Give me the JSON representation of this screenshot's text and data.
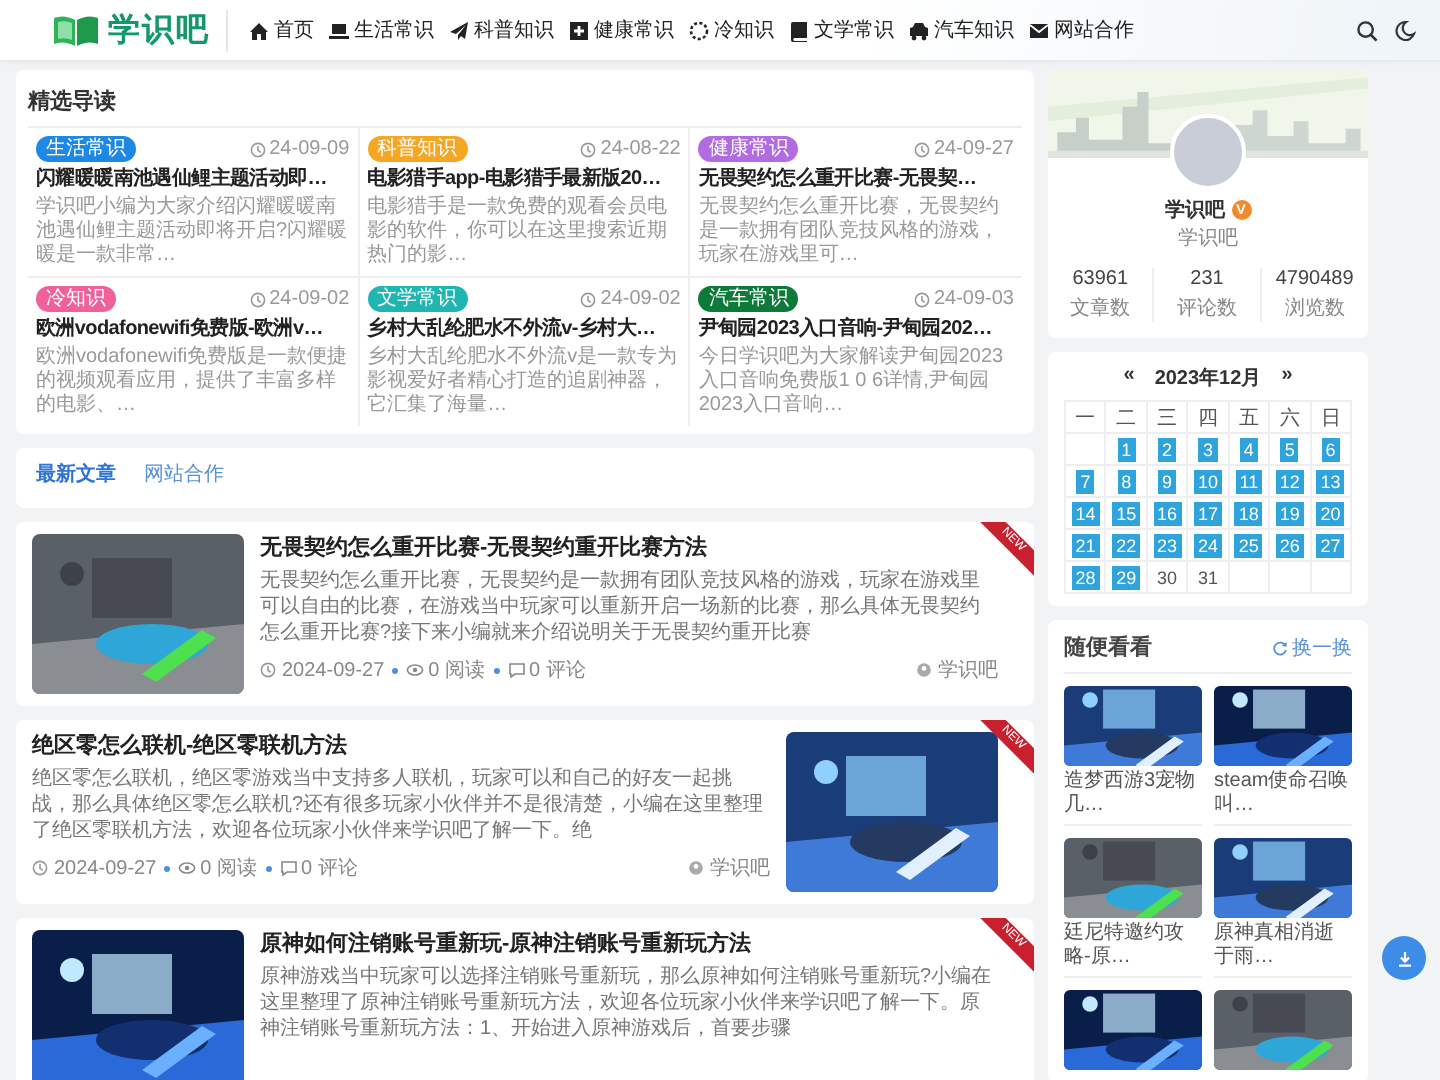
{
  "header": {
    "logo_text": "学识吧",
    "nav": [
      {
        "label": "首页"
      },
      {
        "label": "生活常识"
      },
      {
        "label": "科普知识"
      },
      {
        "label": "健康常识"
      },
      {
        "label": "冷知识"
      },
      {
        "label": "文学常识"
      },
      {
        "label": "汽车知识"
      },
      {
        "label": "网站合作"
      }
    ]
  },
  "featured": {
    "title": "精选导读",
    "items": [
      {
        "tag": "生活常识",
        "color": "#1e88e5",
        "date": "24-09-09",
        "title": "闪耀暖暖南池遇仙鲤主题活动即…",
        "excerpt": "学识吧小编为大家介绍闪耀暖暖南池遇仙鲤主题活动即将开启?闪耀暖暖是一款非常…"
      },
      {
        "tag": "科普知识",
        "color": "#f5a623",
        "date": "24-08-22",
        "title": "电影猎手app-电影猎手最新版20…",
        "excerpt": "电影猎手是一款免费的观看会员电影的软件，你可以在这里搜索近期热门的影…"
      },
      {
        "tag": "健康常识",
        "color": "#b36be0",
        "date": "24-09-27",
        "title": "无畏契约怎么重开比赛-无畏契…",
        "excerpt": "无畏契约怎么重开比赛，无畏契约是一款拥有团队竞技风格的游戏，玩家在游戏里可…"
      },
      {
        "tag": "冷知识",
        "color": "#f0609a",
        "date": "24-09-02",
        "title": "欧洲vodafonewifi免费版-欧洲v…",
        "excerpt": "欧洲vodafonewifi免费版是一款便捷的视频观看应用，提供了丰富多样的电影、…"
      },
      {
        "tag": "文学常识",
        "color": "#1fb5b0",
        "date": "24-09-02",
        "title": "乡村大乱纶肥水不外流v-乡村大…",
        "excerpt": "乡村大乱纶肥水不外流v是一款专为影视爱好者精心打造的追剧神器，它汇集了海量…"
      },
      {
        "tag": "汽车常识",
        "color": "#0e7a3a",
        "date": "24-09-03",
        "title": "尹甸园2023入口音响-尹甸园202…",
        "excerpt": "今日学识吧为大家解读尹甸园2023入口音响免费版1 0 6详情,尹甸园2023入口音响…"
      }
    ]
  },
  "tabs": [
    {
      "label": "最新文章",
      "selected": true
    },
    {
      "label": "网站合作",
      "selected": false
    }
  ],
  "articles": [
    {
      "image_on_right": false,
      "ribbon": "NEW",
      "title": "无畏契约怎么重开比赛-无畏契约重开比赛方法",
      "excerpt": "无畏契约怎么重开比赛，无畏契约是一款拥有团队竞技风格的游戏，玩家在游戏里可以自由的比赛，在游戏当中玩家可以重新开启一场新的比赛，那么具体无畏契约怎么重开比赛?接下来小编就来介绍说明关于无畏契约重开比赛",
      "date": "2024-09-27",
      "views": "0 阅读",
      "comments": "0 评论",
      "author": "学识吧"
    },
    {
      "image_on_right": true,
      "ribbon": "NEW",
      "title": "绝区零怎么联机-绝区零联机方法",
      "excerpt": "绝区零怎么联机，绝区零游戏当中支持多人联机，玩家可以和自己的好友一起挑战，那么具体绝区零怎么联机?还有很多玩家小伙伴并不是很清楚，小编在这里整理了绝区零联机方法，欢迎各位玩家小伙伴来学识吧了解一下。绝",
      "date": "2024-09-27",
      "views": "0 阅读",
      "comments": "0 评论",
      "author": "学识吧"
    },
    {
      "image_on_right": false,
      "ribbon": "NEW",
      "title": "原神如何注销账号重新玩-原神注销账号重新玩方法",
      "excerpt": "原神游戏当中玩家可以选择注销账号重新玩，那么原神如何注销账号重新玩?小编在这里整理了原神注销账号重新玩方法，欢迎各位玩家小伙伴来学识吧了解一下。原神注销账号重新玩方法：1、开始进入原神游戏后，首要步骤"
    }
  ],
  "profile": {
    "name": "学识吧",
    "badge": "V",
    "subtitle": "学识吧",
    "stats": [
      {
        "value": "63961",
        "label": "文章数"
      },
      {
        "value": "231",
        "label": "评论数"
      },
      {
        "value": "4790489",
        "label": "浏览数"
      }
    ]
  },
  "calendar": {
    "prev": "«",
    "month": "2023年12月",
    "next": "»",
    "weekdays": [
      "一",
      "二",
      "三",
      "四",
      "五",
      "六",
      "日"
    ],
    "weeks": [
      [
        {
          "kind": "blank"
        },
        {
          "kind": "day",
          "day": "1",
          "linked": true
        },
        {
          "kind": "day",
          "day": "2",
          "linked": true
        },
        {
          "kind": "day",
          "day": "3",
          "linked": true
        },
        {
          "kind": "day",
          "day": "4",
          "linked": true
        },
        {
          "kind": "day",
          "day": "5",
          "linked": true
        },
        {
          "kind": "day",
          "day": "6",
          "linked": true
        }
      ],
      [
        {
          "kind": "day",
          "day": "7",
          "linked": true
        },
        {
          "kind": "day",
          "day": "8",
          "linked": true
        },
        {
          "kind": "day",
          "day": "9",
          "linked": true
        },
        {
          "kind": "day",
          "day": "10",
          "linked": true
        },
        {
          "kind": "day",
          "day": "11",
          "linked": true
        },
        {
          "kind": "day",
          "day": "12",
          "linked": true
        },
        {
          "kind": "day",
          "day": "13",
          "linked": true
        }
      ],
      [
        {
          "kind": "day",
          "day": "14",
          "linked": true
        },
        {
          "kind": "day",
          "day": "15",
          "linked": true
        },
        {
          "kind": "day",
          "day": "16",
          "linked": true
        },
        {
          "kind": "day",
          "day": "17",
          "linked": true
        },
        {
          "kind": "day",
          "day": "18",
          "linked": true
        },
        {
          "kind": "day",
          "day": "19",
          "linked": true
        },
        {
          "kind": "day",
          "day": "20",
          "linked": true
        }
      ],
      [
        {
          "kind": "day",
          "day": "21",
          "linked": true
        },
        {
          "kind": "day",
          "day": "22",
          "linked": true
        },
        {
          "kind": "day",
          "day": "23",
          "linked": true
        },
        {
          "kind": "day",
          "day": "24",
          "linked": true
        },
        {
          "kind": "day",
          "day": "25",
          "linked": true
        },
        {
          "kind": "day",
          "day": "26",
          "linked": true
        },
        {
          "kind": "day",
          "day": "27",
          "linked": true
        }
      ],
      [
        {
          "kind": "day",
          "day": "28",
          "linked": true
        },
        {
          "kind": "day",
          "day": "29",
          "linked": true
        },
        {
          "kind": "day",
          "day": "30",
          "linked": false
        },
        {
          "kind": "day",
          "day": "31",
          "linked": false
        },
        {
          "kind": "blank"
        },
        {
          "kind": "blank"
        },
        {
          "kind": "blank"
        }
      ]
    ]
  },
  "random": {
    "title": "随便看看",
    "refresh": "换一换",
    "items": [
      {
        "kind": "post",
        "caption": "造梦西游3宠物几…"
      },
      {
        "kind": "post",
        "caption": "steam使命召唤叫…"
      },
      {
        "kind": "post",
        "caption": "廷尼特邀约攻略-原…"
      },
      {
        "kind": "post",
        "caption": "原神真相消逝于雨…"
      },
      {
        "kind": "picture"
      },
      {
        "kind": "picture"
      }
    ]
  }
}
